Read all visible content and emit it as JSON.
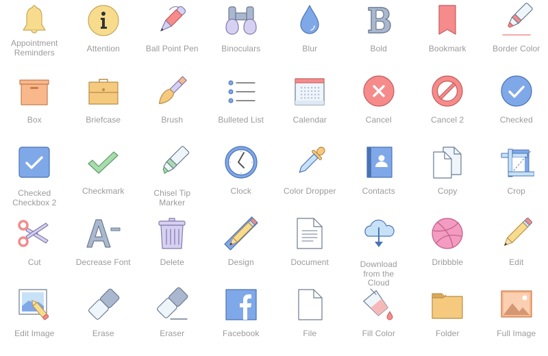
{
  "icons": [
    {
      "label": "Appointment Reminders",
      "icon": "bell-icon"
    },
    {
      "label": "Attention",
      "icon": "info-icon"
    },
    {
      "label": "Ball Point Pen",
      "icon": "ball-point-pen-icon"
    },
    {
      "label": "Binoculars",
      "icon": "binoculars-icon"
    },
    {
      "label": "Blur",
      "icon": "water-drop-icon"
    },
    {
      "label": "Bold",
      "icon": "bold-b-icon"
    },
    {
      "label": "Bookmark",
      "icon": "bookmark-ribbon-icon"
    },
    {
      "label": "Border Color",
      "icon": "marker-underline-icon"
    },
    {
      "label": "Box",
      "icon": "box-icon"
    },
    {
      "label": "Briefcase",
      "icon": "briefcase-icon"
    },
    {
      "label": "Brush",
      "icon": "paint-brush-icon"
    },
    {
      "label": "Bulleted List",
      "icon": "bulleted-list-icon"
    },
    {
      "label": "Calendar",
      "icon": "calendar-icon"
    },
    {
      "label": "Cancel",
      "icon": "cancel-x-circle-icon"
    },
    {
      "label": "Cancel 2",
      "icon": "prohibited-icon"
    },
    {
      "label": "Checked",
      "icon": "check-circle-icon"
    },
    {
      "label": "Checked Checkbox 2",
      "icon": "checked-checkbox-icon"
    },
    {
      "label": "Checkmark",
      "icon": "checkmark-icon"
    },
    {
      "label": "Chisel Tip Marker",
      "icon": "chisel-marker-icon"
    },
    {
      "label": "Clock",
      "icon": "clock-icon"
    },
    {
      "label": "Color Dropper",
      "icon": "color-dropper-icon"
    },
    {
      "label": "Contacts",
      "icon": "contacts-book-icon"
    },
    {
      "label": "Copy",
      "icon": "copy-pages-icon"
    },
    {
      "label": "Crop",
      "icon": "crop-icon"
    },
    {
      "label": "Cut",
      "icon": "scissors-icon"
    },
    {
      "label": "Decrease Font",
      "icon": "decrease-font-icon"
    },
    {
      "label": "Delete",
      "icon": "trash-can-icon"
    },
    {
      "label": "Design",
      "icon": "ruler-pencil-icon"
    },
    {
      "label": "Document",
      "icon": "document-icon"
    },
    {
      "label": "Download from the Cloud",
      "icon": "cloud-download-icon"
    },
    {
      "label": "Dribbble",
      "icon": "dribbble-ball-icon"
    },
    {
      "label": "Edit",
      "icon": "pencil-icon"
    },
    {
      "label": "Edit Image",
      "icon": "edit-image-icon"
    },
    {
      "label": "Erase",
      "icon": "eraser-icon"
    },
    {
      "label": "Eraser",
      "icon": "eraser-line-icon"
    },
    {
      "label": "Facebook",
      "icon": "facebook-icon"
    },
    {
      "label": "File",
      "icon": "blank-file-icon"
    },
    {
      "label": "Fill Color",
      "icon": "paint-bucket-icon"
    },
    {
      "label": "Folder",
      "icon": "folder-icon"
    },
    {
      "label": "Full Image",
      "icon": "landscape-image-icon"
    }
  ],
  "colors": {
    "label": "#9a9a9a",
    "yellow": "#f7dc8e",
    "yellow_stroke": "#c9a85c",
    "red": "#f58b8b",
    "red_stroke": "#c75b5b",
    "blue": "#7fa8e8",
    "blue_stroke": "#4a72b5",
    "gray_blue": "#a9b8cf",
    "gray_stroke": "#6b7a90",
    "purple": "#d6d0f2",
    "purple_stroke": "#8279a8",
    "green": "#a8dcae",
    "green_stroke": "#5a9b63",
    "orange": "#f9b88c",
    "orange_stroke": "#c67a4e",
    "tan": "#f5ca7f",
    "tan_stroke": "#b88d45",
    "pink": "#f39bc0",
    "pink_stroke": "#c25f8b",
    "light_blue": "#c7e2f7",
    "pale": "#eef5fb"
  }
}
